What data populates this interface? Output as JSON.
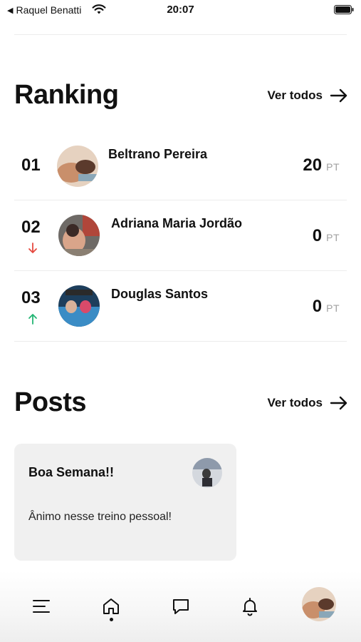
{
  "status_bar": {
    "back_label": "Raquel Benatti",
    "time": "20:07"
  },
  "ranking": {
    "title": "Ranking",
    "see_all": "Ver todos",
    "entries": [
      {
        "position": "01",
        "name": "Beltrano Pereira",
        "points": "20",
        "unit": "PT",
        "trend": "none",
        "avatar_colors": [
          "#c98f6b",
          "#e6d2c0",
          "#5b3a2c"
        ]
      },
      {
        "position": "02",
        "name": "Adriana Maria Jordão",
        "points": "0",
        "unit": "PT",
        "trend": "down",
        "avatar_colors": [
          "#b0463a",
          "#d9a58a",
          "#3b2a26"
        ]
      },
      {
        "position": "03",
        "name": "Douglas Santos",
        "points": "0",
        "unit": "PT",
        "trend": "up",
        "avatar_colors": [
          "#3a8cc5",
          "#d94a6a",
          "#1d3e5c"
        ]
      }
    ]
  },
  "posts": {
    "title": "Posts",
    "see_all": "Ver todos",
    "items": [
      {
        "title": "Boa Semana!!",
        "body": "Ânimo nesse treino pessoal!"
      }
    ]
  },
  "tab_bar": {
    "items": [
      "menu-icon",
      "home-icon",
      "chat-icon",
      "bell-icon",
      "profile-avatar"
    ],
    "active": "home-icon"
  },
  "colors": {
    "trend_down": "#e5483f",
    "trend_up": "#22b573",
    "muted": "#a0a0a0",
    "card_bg": "#f0f0f0"
  }
}
